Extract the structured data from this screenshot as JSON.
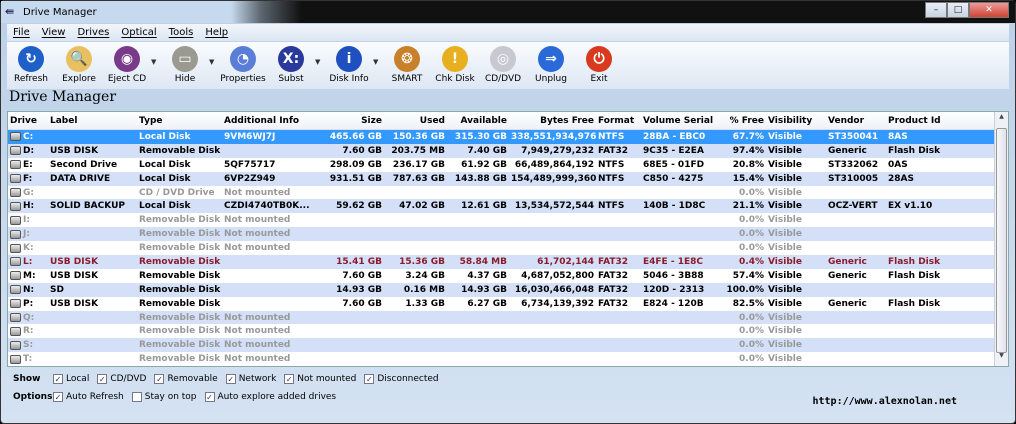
{
  "window": {
    "title": "Drive Manager"
  },
  "menu": [
    "File",
    "View",
    "Drives",
    "Optical",
    "Tools",
    "Help"
  ],
  "toolbar": [
    {
      "label": "Refresh",
      "icon": "refresh-icon",
      "color": "#1e5fc8",
      "glyph": "↻",
      "dd": false
    },
    {
      "label": "Explore",
      "icon": "explore-folder-icon",
      "color": "#e8c060",
      "glyph": "🔍",
      "dd": false
    },
    {
      "label": "Eject CD",
      "icon": "eject-cd-icon",
      "color": "#7a3a8a",
      "glyph": "◉",
      "dd": true
    },
    {
      "label": "Hide",
      "icon": "hide-drive-icon",
      "color": "#9a9a90",
      "glyph": "▭",
      "dd": true
    },
    {
      "label": "Properties",
      "icon": "properties-pie-icon",
      "color": "#5a7ed8",
      "glyph": "◔",
      "dd": false
    },
    {
      "label": "Subst",
      "icon": "subst-icon",
      "color": "#2a3a9a",
      "glyph": "X:",
      "dd": true
    },
    {
      "label": "Disk Info",
      "icon": "disk-info-icon",
      "color": "#2050c0",
      "glyph": "i",
      "dd": true
    },
    {
      "label": "SMART",
      "icon": "brain-icon",
      "color": "#c8802a",
      "glyph": "❂",
      "dd": false
    },
    {
      "label": "Chk Disk",
      "icon": "warning-icon",
      "color": "#e8b020",
      "glyph": "!",
      "dd": false
    },
    {
      "label": "CD/DVD",
      "icon": "cd-dvd-icon",
      "color": "#c8c8d0",
      "glyph": "◎",
      "dd": false
    },
    {
      "label": "Unplug",
      "icon": "unplug-icon",
      "color": "#2a6ad8",
      "glyph": "⇒",
      "dd": false
    },
    {
      "label": "Exit",
      "icon": "exit-icon",
      "color": "#d83a20",
      "glyph": "⏻",
      "dd": false
    }
  ],
  "heading": "Drive Manager",
  "columns": [
    "Drive",
    "Label",
    "Type",
    "Additional Info",
    "Size",
    "Used",
    "Available",
    "Bytes Free",
    "Format",
    "Volume Serial",
    "% Free",
    "Visibility",
    "Vendor",
    "Product Id"
  ],
  "rows": [
    {
      "state": "sel",
      "cells": [
        "C:",
        "",
        "Local Disk",
        "9VM6WJ7J",
        "465.66 GB",
        "150.36 GB",
        "315.30 GB",
        "338,551,934,976",
        "NTFS",
        "28BA - EBC0",
        "67.7%",
        "Visible",
        "ST350041",
        "8AS"
      ]
    },
    {
      "state": "",
      "cells": [
        "D:",
        "USB DISK",
        "Removable Disk",
        "",
        "7.60 GB",
        "203.75 MB",
        "7.40 GB",
        "7,949,279,232",
        "FAT32",
        "9C35 - E2EA",
        "97.4%",
        "Visible",
        "Generic",
        "Flash Disk"
      ]
    },
    {
      "state": "",
      "cells": [
        "E:",
        "Second Drive",
        "Local Disk",
        "5QF75717",
        "298.09 GB",
        "236.17 GB",
        "61.92 GB",
        "66,489,864,192",
        "NTFS",
        "68E5 - 01FD",
        "20.8%",
        "Visible",
        "ST332062",
        "0AS"
      ]
    },
    {
      "state": "",
      "cells": [
        "F:",
        "DATA DRIVE",
        "Local Disk",
        "6VP2Z949",
        "931.51 GB",
        "787.63 GB",
        "143.88 GB",
        "154,489,999,360",
        "NTFS",
        "C850 - 4275",
        "15.4%",
        "Visible",
        "ST310005",
        "28AS"
      ]
    },
    {
      "state": "dim",
      "cells": [
        "G:",
        "",
        "CD / DVD Drive",
        "Not mounted",
        "",
        "",
        "",
        "",
        "",
        "",
        "0.0%",
        "Visible",
        "",
        ""
      ]
    },
    {
      "state": "",
      "cells": [
        "H:",
        "SOLID BACKUP",
        "Local Disk",
        "CZDI4740TB0K...",
        "59.62 GB",
        "47.02 GB",
        "12.61 GB",
        "13,534,572,544",
        "NTFS",
        "140B - 1D8C",
        "21.1%",
        "Visible",
        "OCZ-VERT",
        "EX v1.10"
      ]
    },
    {
      "state": "dim",
      "cells": [
        "I:",
        "",
        "Removable Disk",
        "Not mounted",
        "",
        "",
        "",
        "",
        "",
        "",
        "0.0%",
        "Visible",
        "",
        ""
      ]
    },
    {
      "state": "dim",
      "cells": [
        "J:",
        "",
        "Removable Disk",
        "Not mounted",
        "",
        "",
        "",
        "",
        "",
        "",
        "0.0%",
        "Visible",
        "",
        ""
      ]
    },
    {
      "state": "dim",
      "cells": [
        "K:",
        "",
        "Removable Disk",
        "Not mounted",
        "",
        "",
        "",
        "",
        "",
        "",
        "0.0%",
        "Visible",
        "",
        ""
      ]
    },
    {
      "state": "warn",
      "cells": [
        "L:",
        "USB DISK",
        "Removable Disk",
        "",
        "15.41 GB",
        "15.36 GB",
        "58.84 MB",
        "61,702,144",
        "FAT32",
        "E4FE - 1E8C",
        "0.4%",
        "Visible",
        "Generic",
        "Flash Disk"
      ]
    },
    {
      "state": "",
      "cells": [
        "M:",
        "USB DISK",
        "Removable Disk",
        "",
        "7.60 GB",
        "3.24 GB",
        "4.37 GB",
        "4,687,052,800",
        "FAT32",
        "5046 - 3B88",
        "57.4%",
        "Visible",
        "Generic",
        "Flash Disk"
      ]
    },
    {
      "state": "",
      "cells": [
        "N:",
        "SD",
        "Removable Disk",
        "",
        "14.93 GB",
        "0.16 MB",
        "14.93 GB",
        "16,030,466,048",
        "FAT32",
        "120D - 2313",
        "100.0%",
        "Visible",
        "",
        ""
      ]
    },
    {
      "state": "",
      "cells": [
        "P:",
        "USB DISK",
        "Removable Disk",
        "",
        "7.60 GB",
        "1.33 GB",
        "6.27 GB",
        "6,734,139,392",
        "FAT32",
        "E824 - 120B",
        "82.5%",
        "Visible",
        "Generic",
        "Flash Disk"
      ]
    },
    {
      "state": "dim",
      "cells": [
        "Q:",
        "",
        "Removable Disk",
        "Not mounted",
        "",
        "",
        "",
        "",
        "",
        "",
        "0.0%",
        "Visible",
        "",
        ""
      ]
    },
    {
      "state": "dim",
      "cells": [
        "R:",
        "",
        "Removable Disk",
        "Not mounted",
        "",
        "",
        "",
        "",
        "",
        "",
        "0.0%",
        "Visible",
        "",
        ""
      ]
    },
    {
      "state": "dim",
      "cells": [
        "S:",
        "",
        "Removable Disk",
        "Not mounted",
        "",
        "",
        "",
        "",
        "",
        "",
        "0.0%",
        "Visible",
        "",
        ""
      ]
    },
    {
      "state": "dim",
      "cells": [
        "T:",
        "",
        "Removable Disk",
        "Not mounted",
        "",
        "",
        "",
        "",
        "",
        "",
        "0.0%",
        "Visible",
        "",
        ""
      ]
    }
  ],
  "show": {
    "label": "Show",
    "items": [
      {
        "label": "Local",
        "checked": true
      },
      {
        "label": "CD/DVD",
        "checked": true
      },
      {
        "label": "Removable",
        "checked": true
      },
      {
        "label": "Network",
        "checked": true
      },
      {
        "label": "Not mounted",
        "checked": true
      },
      {
        "label": "Disconnected",
        "checked": true
      }
    ]
  },
  "options": {
    "label": "Options",
    "items": [
      {
        "label": "Auto Refresh",
        "checked": true
      },
      {
        "label": "Stay on top",
        "checked": false
      },
      {
        "label": "Auto explore added drives",
        "checked": true
      }
    ]
  },
  "url": "http://www.alexnolan.net"
}
